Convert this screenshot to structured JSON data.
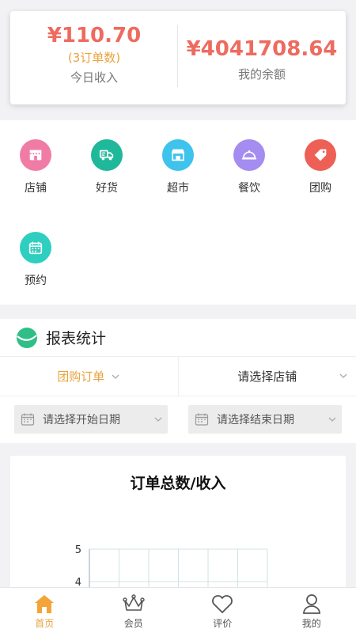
{
  "summary": {
    "today_amount": "¥110.70",
    "today_orders": "(3订单数)",
    "today_label": "今日收入",
    "balance_amount": "¥4041708.64",
    "balance_label": "我的余额"
  },
  "categories": [
    {
      "label": "店铺",
      "icon": "shop-icon",
      "color": "#f07ca5"
    },
    {
      "label": "好货",
      "icon": "delivery-truck-icon",
      "color": "#1fb89a"
    },
    {
      "label": "超市",
      "icon": "storefront-icon",
      "color": "#3ec3ec"
    },
    {
      "label": "餐饮",
      "icon": "food-tray-icon",
      "color": "#a48cf0"
    },
    {
      "label": "团购",
      "icon": "tag-icon",
      "color": "#ee5f55"
    },
    {
      "label": "预约",
      "icon": "calendar-icon",
      "color": "#2ecfc0"
    }
  ],
  "report": {
    "title": "报表统计",
    "order_type": "团购订单",
    "store_select": "请选择店铺",
    "start_date_placeholder": "请选择开始日期",
    "end_date_placeholder": "请选择结束日期"
  },
  "chart_data": {
    "type": "line",
    "title": "订单总数/收入",
    "y_ticks": [
      "5",
      "4"
    ],
    "grid": true
  },
  "tabbar": [
    {
      "label": "首页",
      "icon": "home-icon",
      "active": true
    },
    {
      "label": "会员",
      "icon": "crown-icon",
      "active": false
    },
    {
      "label": "评价",
      "icon": "heart-icon",
      "active": false
    },
    {
      "label": "我的",
      "icon": "user-icon",
      "active": false
    }
  ],
  "colors": {
    "accent": "#e8a33d",
    "amount": "#ee6b5f"
  }
}
